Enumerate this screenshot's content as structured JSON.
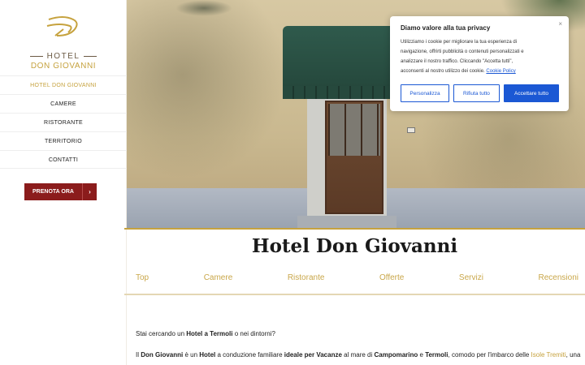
{
  "logo": {
    "line1": "HOTEL",
    "line2": "DON GIOVANNI",
    "icon": "don-giovanni-monogram"
  },
  "nav": {
    "items": [
      {
        "label": "HOTEL DON GIOVANNI",
        "active": true
      },
      {
        "label": "CAMERE"
      },
      {
        "label": "RISTORANTE"
      },
      {
        "label": "TERRITORIO"
      },
      {
        "label": "CONTATTI"
      }
    ]
  },
  "book": {
    "label": "PRENOTA ORA",
    "arrow": "›"
  },
  "privacy": {
    "title": "Diamo valore alla tua privacy",
    "text": "Utilizziamo i cookie per migliorare la tua esperienza di navigazione, offrirti pubblicità o contenuti personalizzati e analizzare il nostro traffico. Cliccando \"Accetta tutti\", acconsenti al nostro utilizzo dei cookie.",
    "line1": "Utilizziamo i cookie per migliorare la tua esperienza di",
    "line2": "navigazione, offrirti pubblicità o contenuti personalizzati e",
    "line3": "analizzare il nostro traffico. Cliccando \"Accetta tutti\",",
    "line4": "acconsenti al nostro utilizzo dei cookie.",
    "link": "Cookie Policy",
    "close": "×",
    "btn_customize": "Personalizza",
    "btn_reject": "Rifiuta tutto",
    "btn_accept": "Accettare tutto",
    "accent": "#1b58d4"
  },
  "main": {
    "title": "Hotel Don Giovanni",
    "tabs": [
      "Top",
      "Camere",
      "Ristorante",
      "Offerte",
      "Servizi",
      "Recensioni"
    ]
  },
  "content": {
    "p1_a": "Stai cercando un ",
    "p1_b": "Hotel a Termoli",
    "p1_c": " o nei dintorni?",
    "p2_a": "Il ",
    "p2_b": "Don Giovanni",
    "p2_c": " è un ",
    "p2_d": "Hotel",
    "p2_e": " a conduzione familiare ",
    "p2_f": "ideale per Vacanze",
    "p2_g": " al mare di ",
    "p2_h": "Campomarino",
    "p2_i": " e ",
    "p2_j": "Termoli",
    "p2_k": ", comodo per l'imbarco delle ",
    "p2_l": "Isole Tremiti",
    "p2_m": ", una"
  },
  "colors": {
    "gold": "#c6a23e",
    "burgundy": "#8b1c1c",
    "blue": "#1b58d4"
  }
}
